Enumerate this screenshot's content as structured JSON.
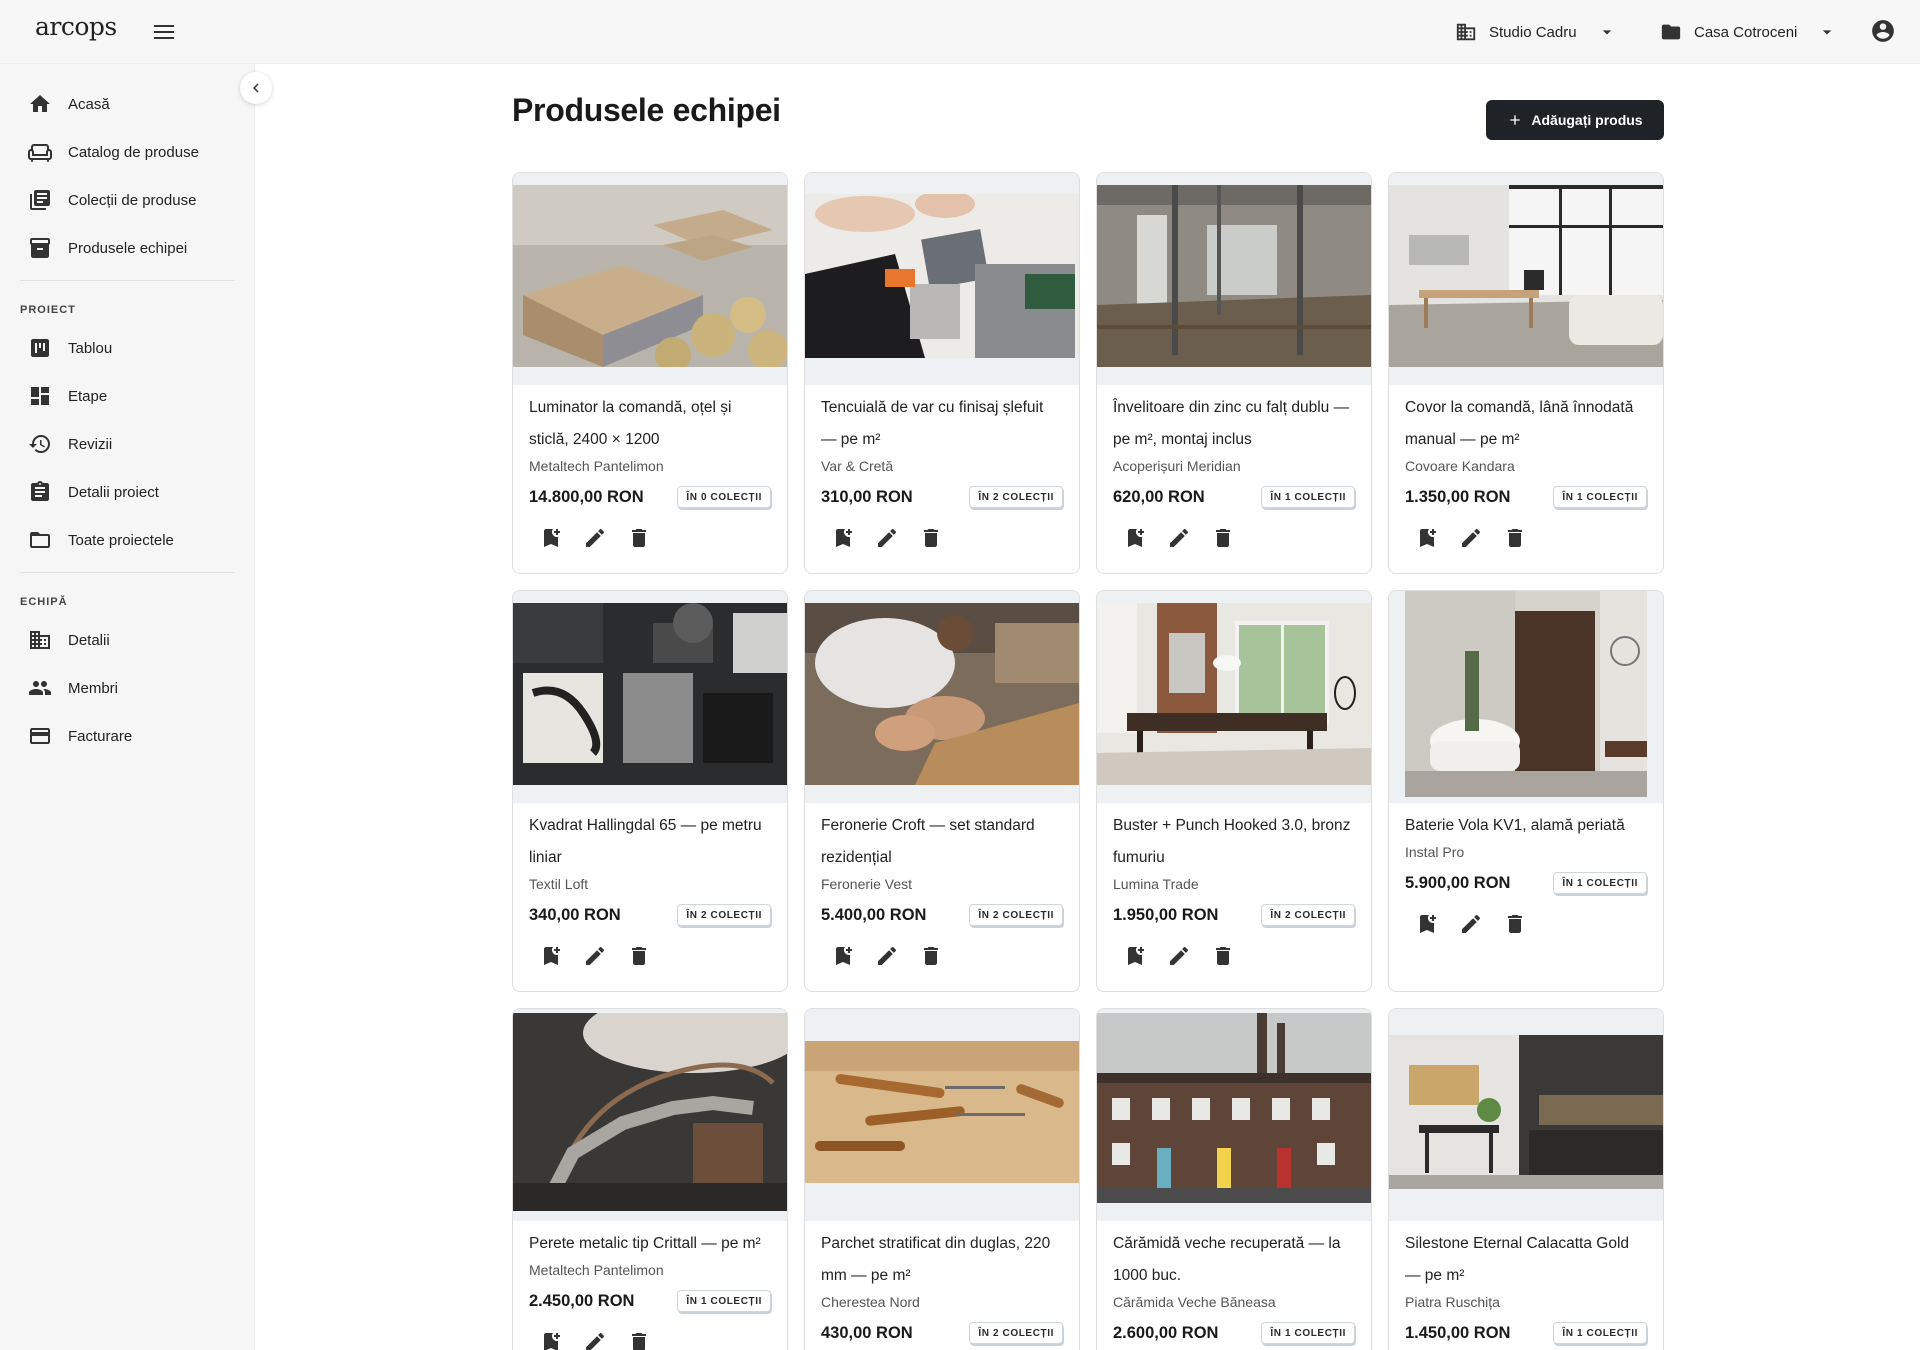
{
  "app": {
    "logo": "arcops"
  },
  "topbar": {
    "studio": "Studio Cadru",
    "project": "Casa Cotroceni"
  },
  "sidebar": {
    "main_items": [
      {
        "label": "Acasă",
        "icon": "home-icon"
      },
      {
        "label": "Catalog de produse",
        "icon": "sofa-icon"
      },
      {
        "label": "Colecții de produse",
        "icon": "library-icon"
      },
      {
        "label": "Produsele echipei",
        "icon": "archive-icon"
      }
    ],
    "project_section": "PROIECT",
    "project_items": [
      {
        "label": "Tablou",
        "icon": "board-icon"
      },
      {
        "label": "Etape",
        "icon": "dashboard-icon"
      },
      {
        "label": "Revizii",
        "icon": "history-icon"
      },
      {
        "label": "Detalii proiect",
        "icon": "clipboard-icon"
      },
      {
        "label": "Toate proiectele",
        "icon": "folder-icon"
      }
    ],
    "team_section": "ECHIPĂ",
    "team_items": [
      {
        "label": "Detalii",
        "icon": "building-icon"
      },
      {
        "label": "Membri",
        "icon": "people-icon"
      },
      {
        "label": "Facturare",
        "icon": "credit-card-icon"
      }
    ]
  },
  "page": {
    "title": "Produsele echipei",
    "add_button": "Adăugați produs"
  },
  "products": [
    {
      "title": "Luminator la comandă, oțel și sticlă, 2400 × 1200",
      "vendor": "Metaltech Pantelimon",
      "price": "14.800,00 RON",
      "badge": "ÎN 0 COLECȚII"
    },
    {
      "title": "Tencuială de var cu finisaj șlefuit — pe m²",
      "vendor": "Var & Cretă",
      "price": "310,00 RON",
      "badge": "ÎN 2 COLECȚII"
    },
    {
      "title": "Învelitoare din zinc cu falț dublu — pe m², montaj inclus",
      "vendor": "Acoperișuri Meridian",
      "price": "620,00 RON",
      "badge": "ÎN 1 COLECȚII"
    },
    {
      "title": "Covor la comandă, lână înnodată manual — pe m²",
      "vendor": "Covoare Kandara",
      "price": "1.350,00 RON",
      "badge": "ÎN 1 COLECȚII"
    },
    {
      "title": "Kvadrat Hallingdal 65 — pe metru liniar",
      "vendor": "Textil Loft",
      "price": "340,00 RON",
      "badge": "ÎN 2 COLECȚII"
    },
    {
      "title": "Feronerie Croft — set standard rezidențial",
      "vendor": "Feronerie Vest",
      "price": "5.400,00 RON",
      "badge": "ÎN 2 COLECȚII"
    },
    {
      "title": "Buster + Punch Hooked 3.0, bronz fumuriu",
      "vendor": "Lumina Trade",
      "price": "1.950,00 RON",
      "badge": "ÎN 2 COLECȚII"
    },
    {
      "title": "Baterie Vola KV1, alamă periată",
      "vendor": "Instal Pro",
      "price": "5.900,00 RON",
      "badge": "ÎN 1 COLECȚII"
    },
    {
      "title": "Perete metalic tip Crittall — pe m²",
      "vendor": "Metaltech Pantelimon",
      "price": "2.450,00 RON",
      "badge": "ÎN 1 COLECȚII"
    },
    {
      "title": "Parchet stratificat din duglas, 220 mm — pe m²",
      "vendor": "Cherestea Nord",
      "price": "430,00 RON",
      "badge": "ÎN 2 COLECȚII"
    },
    {
      "title": "Cărămidă veche recuperată — la 1000 buc.",
      "vendor": "Cărămida Veche Băneasa",
      "price": "2.600,00 RON",
      "badge": "ÎN 1 COLECȚII"
    },
    {
      "title": "Silestone Eternal Calacatta Gold — pe m²",
      "vendor": "Piatra Ruschița",
      "price": "1.450,00 RON",
      "badge": "ÎN 1 COLECȚII"
    }
  ]
}
